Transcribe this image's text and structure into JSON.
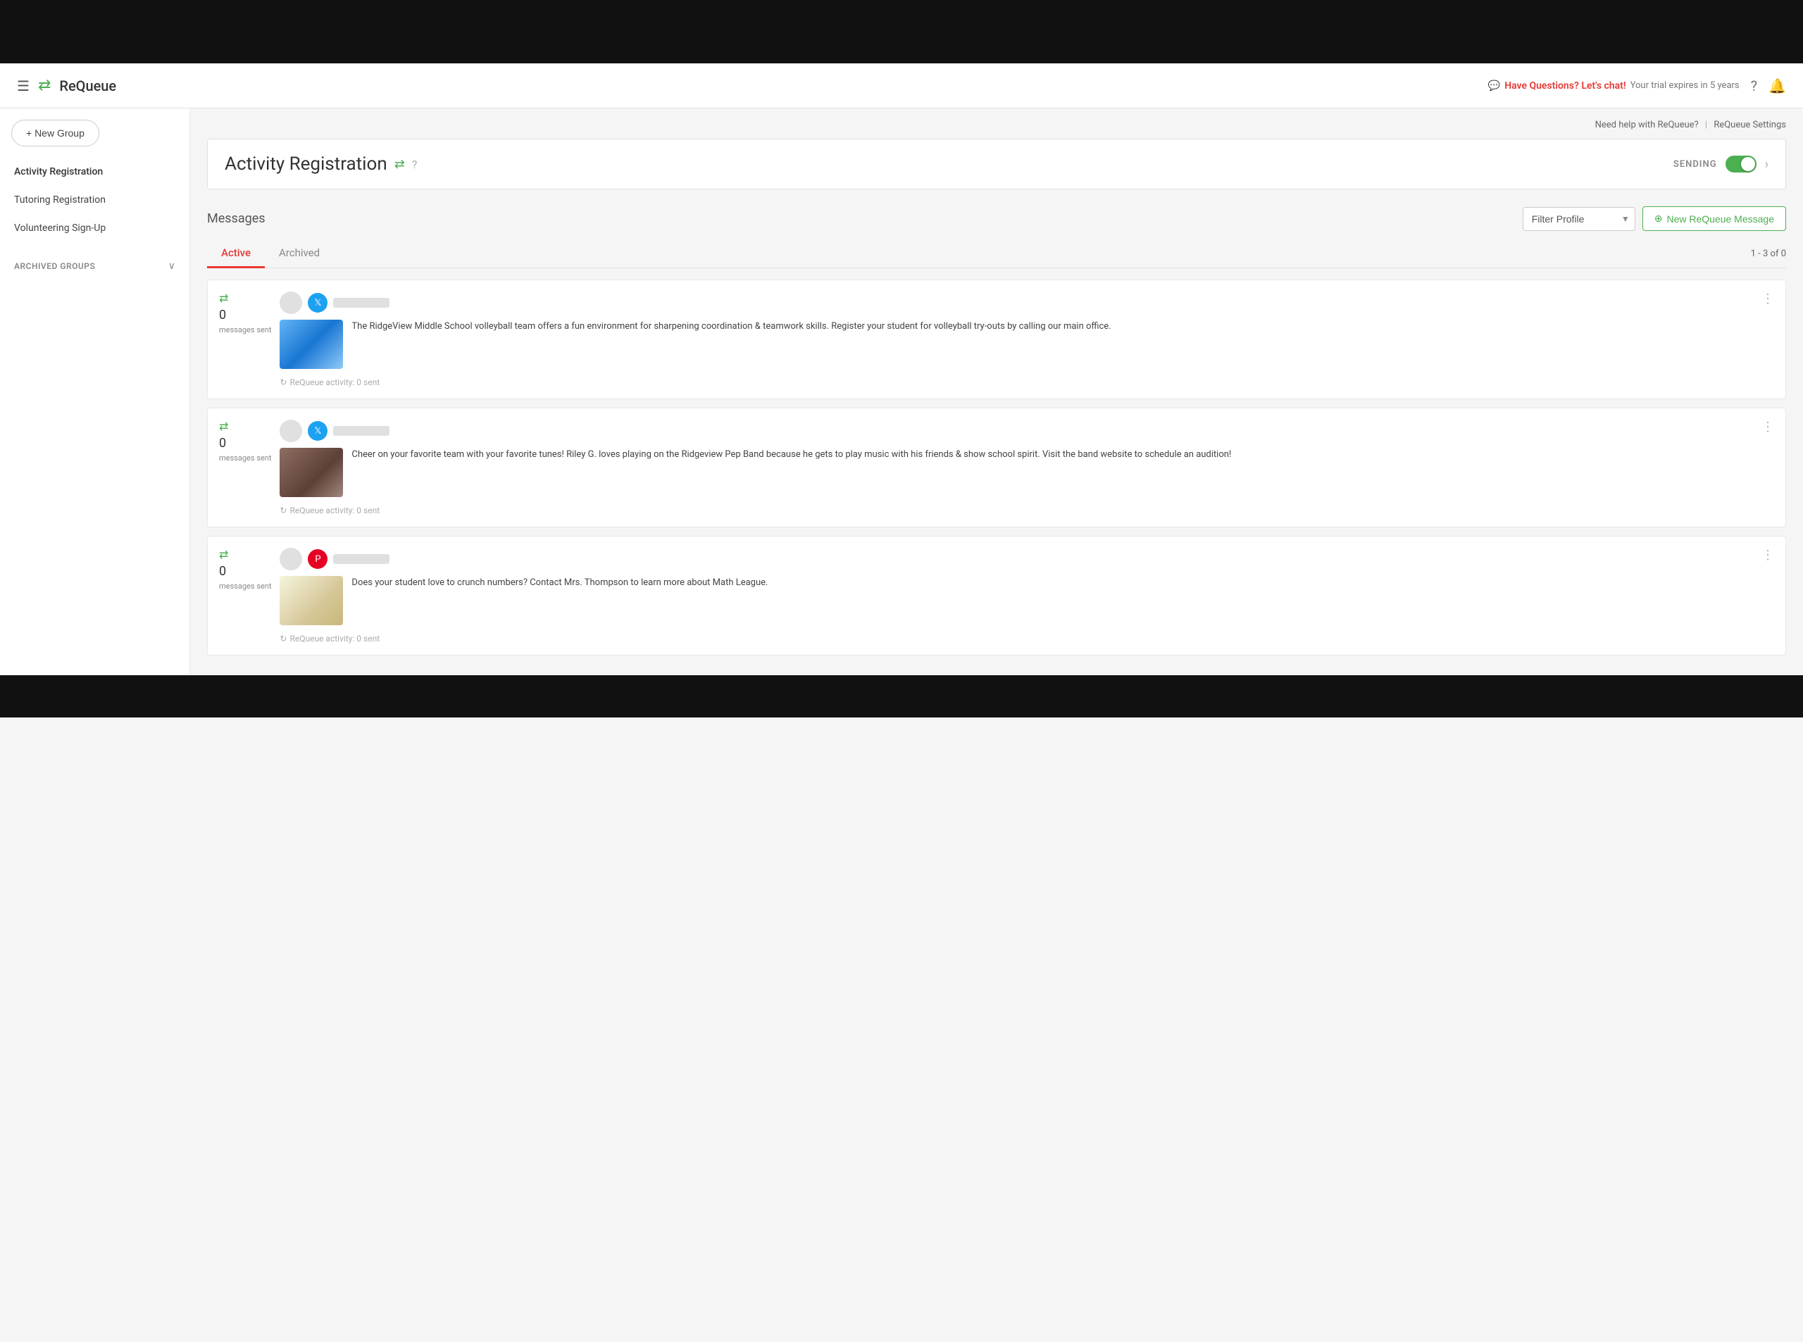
{
  "topBar": {
    "height": "black"
  },
  "header": {
    "appName": "ReQueue",
    "chatPrompt": "Have Questions? Let's chat!",
    "trialText": "Your trial expires in 5 years"
  },
  "topLinks": {
    "help": "Need help with ReQueue?",
    "settings": "ReQueue Settings"
  },
  "sidebar": {
    "newGroupLabel": "+ New Group",
    "items": [
      {
        "label": "Activity Registration",
        "active": true
      },
      {
        "label": "Tutoring Registration",
        "active": false
      },
      {
        "label": "Volunteering Sign-Up",
        "active": false
      }
    ],
    "archivedSection": "ARCHIVED GROUPS"
  },
  "groupHeader": {
    "title": "Activity Registration",
    "sendingLabel": "SENDING"
  },
  "messages": {
    "title": "Messages",
    "filterPlaceholder": "Filter Profile",
    "newMessageLabel": "New ReQueue Message",
    "paginationText": "1 - 3 of 0",
    "tabs": [
      {
        "label": "Active",
        "active": true
      },
      {
        "label": "Archived",
        "active": false
      }
    ],
    "items": [
      {
        "count": "0",
        "statLabel": "messages sent",
        "socialType": "twitter",
        "text": "The RidgeView Middle School volleyball team offers a fun environment for sharpening coordination & teamwork skills. Register your student for volleyball try-outs by calling our main office.",
        "activityText": "ReQueue activity: 0 sent",
        "imgType": "volleyball"
      },
      {
        "count": "0",
        "statLabel": "messages sent",
        "socialType": "twitter",
        "text": "Cheer on your favorite team with your favorite tunes! Riley G. loves playing on the Ridgeview Pep Band because he gets to play music with his friends & show school spirit. Visit the band website to schedule an audition!",
        "activityText": "ReQueue activity: 0 sent",
        "imgType": "band"
      },
      {
        "count": "0",
        "statLabel": "messages sent",
        "socialType": "pinterest",
        "text": "Does your student love to crunch numbers? Contact Mrs. Thompson to learn more about Math League.",
        "activityText": "ReQueue activity: 0 sent",
        "imgType": "math"
      }
    ]
  }
}
